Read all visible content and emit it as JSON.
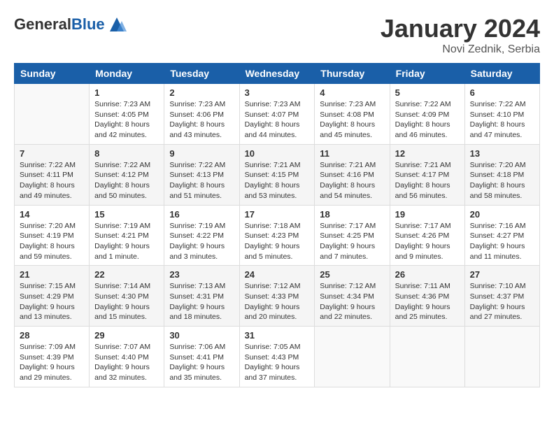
{
  "header": {
    "logo_general": "General",
    "logo_blue": "Blue",
    "month_title": "January 2024",
    "location": "Novi Zednik, Serbia"
  },
  "days_of_week": [
    "Sunday",
    "Monday",
    "Tuesday",
    "Wednesday",
    "Thursday",
    "Friday",
    "Saturday"
  ],
  "weeks": [
    [
      {
        "day": "",
        "sunrise": "",
        "sunset": "",
        "daylight": ""
      },
      {
        "day": "1",
        "sunrise": "Sunrise: 7:23 AM",
        "sunset": "Sunset: 4:05 PM",
        "daylight": "Daylight: 8 hours and 42 minutes."
      },
      {
        "day": "2",
        "sunrise": "Sunrise: 7:23 AM",
        "sunset": "Sunset: 4:06 PM",
        "daylight": "Daylight: 8 hours and 43 minutes."
      },
      {
        "day": "3",
        "sunrise": "Sunrise: 7:23 AM",
        "sunset": "Sunset: 4:07 PM",
        "daylight": "Daylight: 8 hours and 44 minutes."
      },
      {
        "day": "4",
        "sunrise": "Sunrise: 7:23 AM",
        "sunset": "Sunset: 4:08 PM",
        "daylight": "Daylight: 8 hours and 45 minutes."
      },
      {
        "day": "5",
        "sunrise": "Sunrise: 7:22 AM",
        "sunset": "Sunset: 4:09 PM",
        "daylight": "Daylight: 8 hours and 46 minutes."
      },
      {
        "day": "6",
        "sunrise": "Sunrise: 7:22 AM",
        "sunset": "Sunset: 4:10 PM",
        "daylight": "Daylight: 8 hours and 47 minutes."
      }
    ],
    [
      {
        "day": "7",
        "sunrise": "Sunrise: 7:22 AM",
        "sunset": "Sunset: 4:11 PM",
        "daylight": "Daylight: 8 hours and 49 minutes."
      },
      {
        "day": "8",
        "sunrise": "Sunrise: 7:22 AM",
        "sunset": "Sunset: 4:12 PM",
        "daylight": "Daylight: 8 hours and 50 minutes."
      },
      {
        "day": "9",
        "sunrise": "Sunrise: 7:22 AM",
        "sunset": "Sunset: 4:13 PM",
        "daylight": "Daylight: 8 hours and 51 minutes."
      },
      {
        "day": "10",
        "sunrise": "Sunrise: 7:21 AM",
        "sunset": "Sunset: 4:15 PM",
        "daylight": "Daylight: 8 hours and 53 minutes."
      },
      {
        "day": "11",
        "sunrise": "Sunrise: 7:21 AM",
        "sunset": "Sunset: 4:16 PM",
        "daylight": "Daylight: 8 hours and 54 minutes."
      },
      {
        "day": "12",
        "sunrise": "Sunrise: 7:21 AM",
        "sunset": "Sunset: 4:17 PM",
        "daylight": "Daylight: 8 hours and 56 minutes."
      },
      {
        "day": "13",
        "sunrise": "Sunrise: 7:20 AM",
        "sunset": "Sunset: 4:18 PM",
        "daylight": "Daylight: 8 hours and 58 minutes."
      }
    ],
    [
      {
        "day": "14",
        "sunrise": "Sunrise: 7:20 AM",
        "sunset": "Sunset: 4:19 PM",
        "daylight": "Daylight: 8 hours and 59 minutes."
      },
      {
        "day": "15",
        "sunrise": "Sunrise: 7:19 AM",
        "sunset": "Sunset: 4:21 PM",
        "daylight": "Daylight: 9 hours and 1 minute."
      },
      {
        "day": "16",
        "sunrise": "Sunrise: 7:19 AM",
        "sunset": "Sunset: 4:22 PM",
        "daylight": "Daylight: 9 hours and 3 minutes."
      },
      {
        "day": "17",
        "sunrise": "Sunrise: 7:18 AM",
        "sunset": "Sunset: 4:23 PM",
        "daylight": "Daylight: 9 hours and 5 minutes."
      },
      {
        "day": "18",
        "sunrise": "Sunrise: 7:17 AM",
        "sunset": "Sunset: 4:25 PM",
        "daylight": "Daylight: 9 hours and 7 minutes."
      },
      {
        "day": "19",
        "sunrise": "Sunrise: 7:17 AM",
        "sunset": "Sunset: 4:26 PM",
        "daylight": "Daylight: 9 hours and 9 minutes."
      },
      {
        "day": "20",
        "sunrise": "Sunrise: 7:16 AM",
        "sunset": "Sunset: 4:27 PM",
        "daylight": "Daylight: 9 hours and 11 minutes."
      }
    ],
    [
      {
        "day": "21",
        "sunrise": "Sunrise: 7:15 AM",
        "sunset": "Sunset: 4:29 PM",
        "daylight": "Daylight: 9 hours and 13 minutes."
      },
      {
        "day": "22",
        "sunrise": "Sunrise: 7:14 AM",
        "sunset": "Sunset: 4:30 PM",
        "daylight": "Daylight: 9 hours and 15 minutes."
      },
      {
        "day": "23",
        "sunrise": "Sunrise: 7:13 AM",
        "sunset": "Sunset: 4:31 PM",
        "daylight": "Daylight: 9 hours and 18 minutes."
      },
      {
        "day": "24",
        "sunrise": "Sunrise: 7:12 AM",
        "sunset": "Sunset: 4:33 PM",
        "daylight": "Daylight: 9 hours and 20 minutes."
      },
      {
        "day": "25",
        "sunrise": "Sunrise: 7:12 AM",
        "sunset": "Sunset: 4:34 PM",
        "daylight": "Daylight: 9 hours and 22 minutes."
      },
      {
        "day": "26",
        "sunrise": "Sunrise: 7:11 AM",
        "sunset": "Sunset: 4:36 PM",
        "daylight": "Daylight: 9 hours and 25 minutes."
      },
      {
        "day": "27",
        "sunrise": "Sunrise: 7:10 AM",
        "sunset": "Sunset: 4:37 PM",
        "daylight": "Daylight: 9 hours and 27 minutes."
      }
    ],
    [
      {
        "day": "28",
        "sunrise": "Sunrise: 7:09 AM",
        "sunset": "Sunset: 4:39 PM",
        "daylight": "Daylight: 9 hours and 29 minutes."
      },
      {
        "day": "29",
        "sunrise": "Sunrise: 7:07 AM",
        "sunset": "Sunset: 4:40 PM",
        "daylight": "Daylight: 9 hours and 32 minutes."
      },
      {
        "day": "30",
        "sunrise": "Sunrise: 7:06 AM",
        "sunset": "Sunset: 4:41 PM",
        "daylight": "Daylight: 9 hours and 35 minutes."
      },
      {
        "day": "31",
        "sunrise": "Sunrise: 7:05 AM",
        "sunset": "Sunset: 4:43 PM",
        "daylight": "Daylight: 9 hours and 37 minutes."
      },
      {
        "day": "",
        "sunrise": "",
        "sunset": "",
        "daylight": ""
      },
      {
        "day": "",
        "sunrise": "",
        "sunset": "",
        "daylight": ""
      },
      {
        "day": "",
        "sunrise": "",
        "sunset": "",
        "daylight": ""
      }
    ]
  ]
}
